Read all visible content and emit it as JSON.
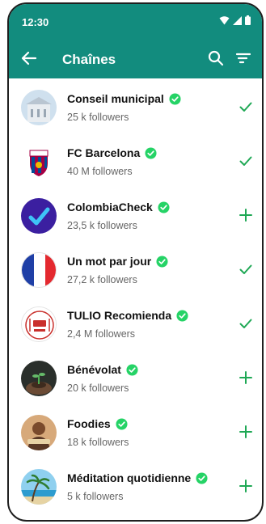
{
  "status_bar": {
    "time": "12:30"
  },
  "header": {
    "title": "Chaînes"
  },
  "channels": [
    {
      "name": "Conseil municipal",
      "followers": "25 k followers",
      "status": "following",
      "avatar": "town-hall"
    },
    {
      "name": "FC Barcelona",
      "followers": "40 M followers",
      "status": "following",
      "avatar": "fcb-crest"
    },
    {
      "name": "ColombiaCheck",
      "followers": "23,5 k followers",
      "status": "follow",
      "avatar": "check-logo"
    },
    {
      "name": "Un mot par jour",
      "followers": "27,2 k followers",
      "status": "following",
      "avatar": "french-flag"
    },
    {
      "name": "TULIO Recomienda",
      "followers": "2,4 M followers",
      "status": "following",
      "avatar": "tulio-logo"
    },
    {
      "name": "Bénévolat",
      "followers": "20 k followers",
      "status": "follow",
      "avatar": "hands-plant"
    },
    {
      "name": "Foodies",
      "followers": "18 k followers",
      "status": "follow",
      "avatar": "person-food"
    },
    {
      "name": "Méditation quotidienne",
      "followers": "5 k followers",
      "status": "follow",
      "avatar": "beach-palm"
    }
  ],
  "colors": {
    "brand": "#128c7e",
    "accent": "#1fa855",
    "verified": "#25d366"
  }
}
